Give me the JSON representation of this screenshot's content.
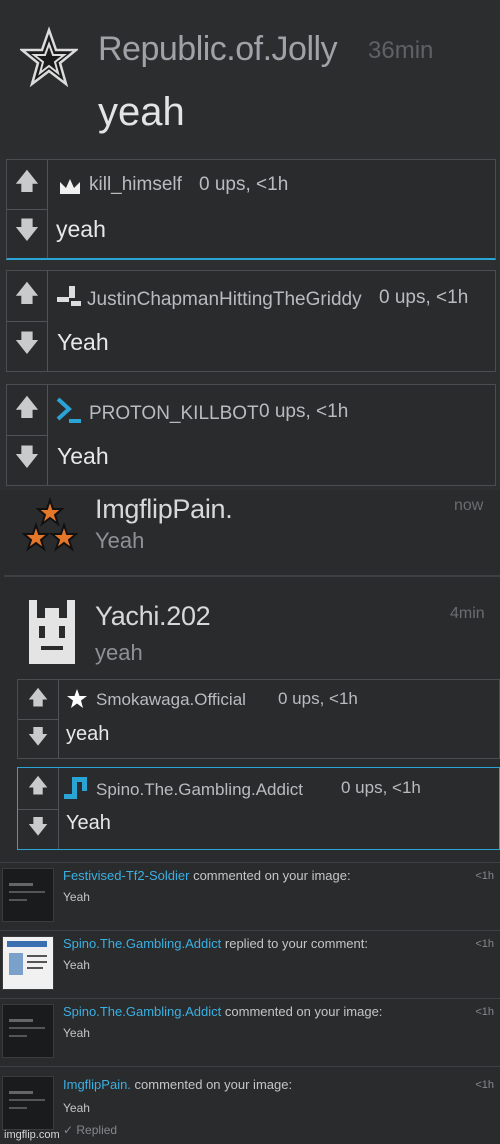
{
  "main_comment": {
    "username": "Republic.of.Jolly",
    "time": "36min",
    "text": "yeah"
  },
  "replies_1": [
    {
      "username": "kill_himself",
      "meta": "0 ups, <1h",
      "text": "yeah",
      "icon": "crown-icon"
    },
    {
      "username": "JustinChapmanHittingTheGriddy",
      "meta": "0 ups, <1h",
      "text": "Yeah",
      "icon": "blocks-icon"
    },
    {
      "username": "PROTON_KILLBOT",
      "meta": "0 ups, <1h",
      "text": "Yeah",
      "icon": "terminal-icon"
    }
  ],
  "comments_2": [
    {
      "username": "ImgflipPain.",
      "time": "now",
      "text": "Yeah",
      "icon": "three-stars-icon"
    },
    {
      "username": "Yachi.202",
      "time": "4min",
      "text": "yeah",
      "icon": "face-icon"
    }
  ],
  "replies_2": [
    {
      "username": "Smokawaga.Official",
      "meta": "0 ups, <1h",
      "text": "yeah",
      "icon": "star-icon"
    },
    {
      "username": "Spino.The.Gambling.Addict",
      "meta": "0 ups, <1h",
      "text": "Yeah",
      "icon": "p-block-icon"
    }
  ],
  "notifications": [
    {
      "user": "Festivised-Tf2-Soldier",
      "action": "commented on your image:",
      "text": "Yeah",
      "time": "<1h"
    },
    {
      "user": "Spino.The.Gambling.Addict",
      "action": "replied to your comment:",
      "text": "Yeah",
      "time": "<1h"
    },
    {
      "user": "Spino.The.Gambling.Addict",
      "action": "commented on your image:",
      "text": "Yeah",
      "time": "<1h"
    },
    {
      "user": "ImgflipPain.",
      "action": "commented on your image:",
      "text": "Yeah",
      "time": "<1h",
      "status": "✓ Replied"
    }
  ],
  "watermark": "imgflip.com",
  "colors": {
    "link": "#3ab0e2",
    "highlight": "#2aa3d5",
    "orange_star": "#e5772a"
  }
}
